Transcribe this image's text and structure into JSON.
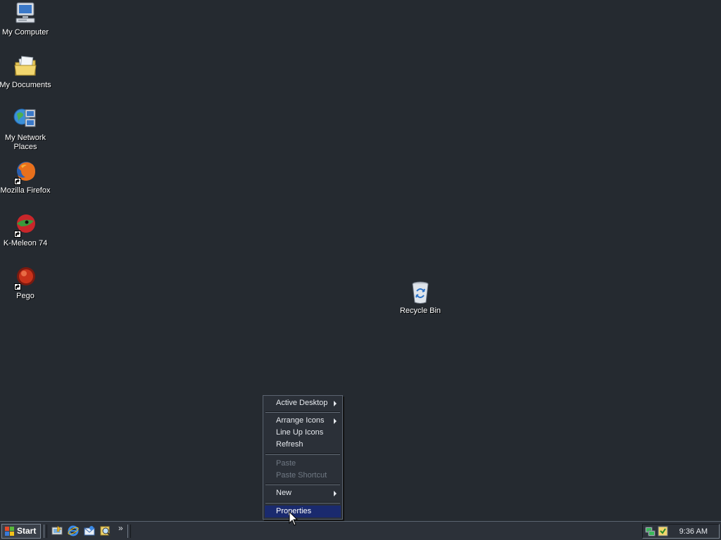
{
  "desktop": {
    "icons": [
      {
        "label": "My Computer",
        "icon": "my-computer-icon"
      },
      {
        "label": "My Documents",
        "icon": "my-documents-icon"
      },
      {
        "label": "My Network Places",
        "icon": "network-places-icon"
      },
      {
        "label": "Mozilla Firefox",
        "icon": "firefox-icon"
      },
      {
        "label": "K-Meleon 74",
        "icon": "k-meleon-icon"
      },
      {
        "label": "Pego",
        "icon": "pego-icon"
      }
    ],
    "recycle_bin": {
      "label": "Recycle Bin",
      "icon": "recycle-bin-icon"
    }
  },
  "context_menu": {
    "items": [
      {
        "label": "Active Desktop",
        "submenu": true,
        "enabled": true
      },
      {
        "label": "Arrange Icons",
        "submenu": true,
        "enabled": true
      },
      {
        "label": "Line Up Icons",
        "enabled": true
      },
      {
        "label": "Refresh",
        "enabled": true
      },
      {
        "label": "Paste",
        "enabled": false
      },
      {
        "label": "Paste Shortcut",
        "enabled": false
      },
      {
        "label": "New",
        "submenu": true,
        "enabled": true
      },
      {
        "label": "Properties",
        "enabled": true,
        "highlighted": true
      }
    ]
  },
  "taskbar": {
    "start_label": "Start",
    "quick_launch": [
      "show-desktop-icon",
      "internet-explorer-icon",
      "outlook-express-icon",
      "search-icon"
    ],
    "overflow": "»",
    "clock": "9:36 AM",
    "tray_icons": [
      "network-tray-icon",
      "security-tray-icon"
    ]
  },
  "colors": {
    "desktop_bg": "#252a30",
    "menu_highlight": "#1a2a6e"
  }
}
